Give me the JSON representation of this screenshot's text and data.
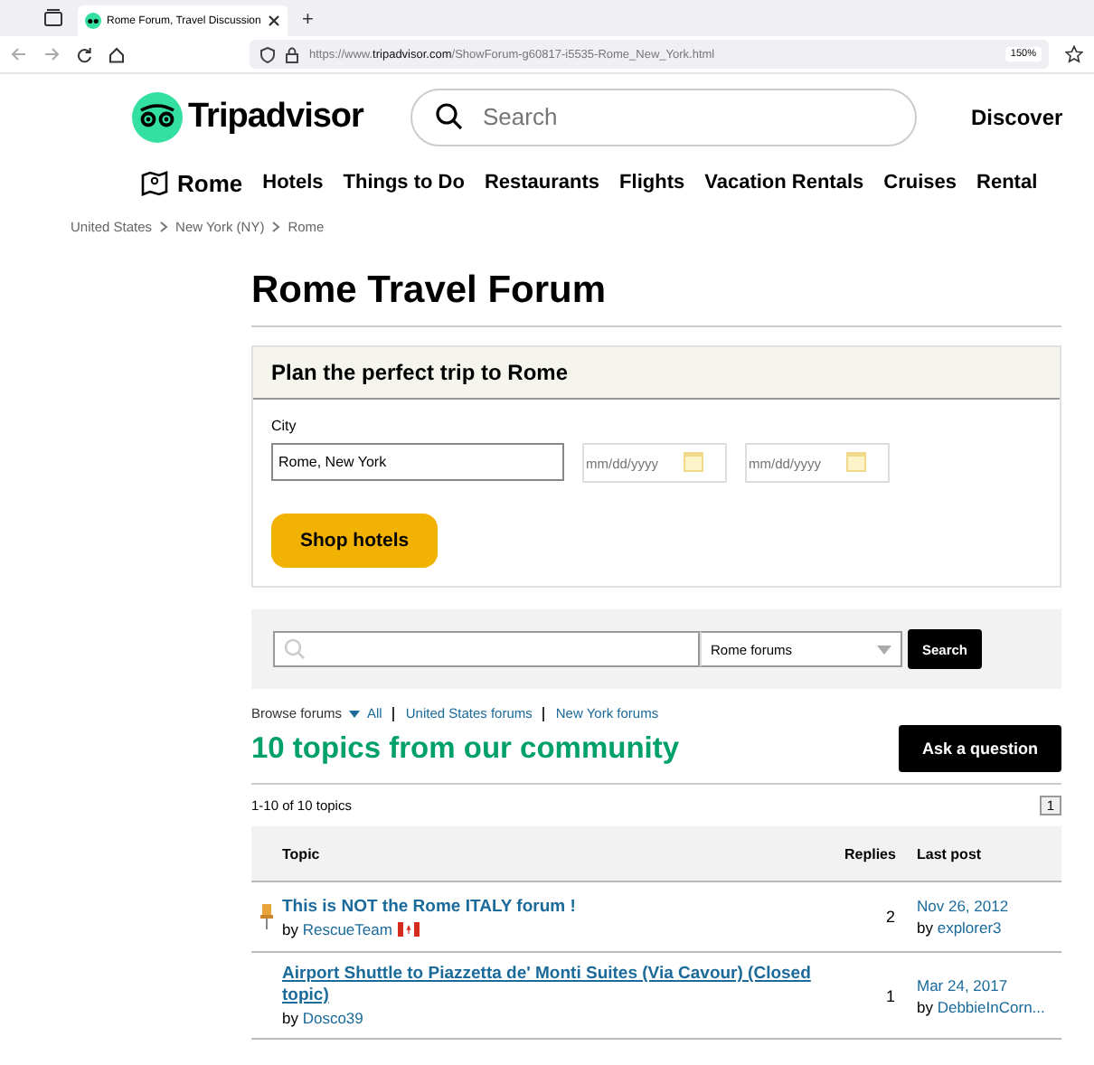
{
  "browser": {
    "tab_title": "Rome Forum, Travel Discussion",
    "new_tab": "+",
    "url_prefix": "https://www.",
    "url_domain": "tripadvisor.com",
    "url_path": "/ShowForum-g60817-i5535-Rome_New_York.html",
    "zoom": "150%"
  },
  "header": {
    "logo": "Tripadvisor",
    "search": {
      "placeholder": "Search"
    },
    "discover": "Discover"
  },
  "nav": [
    {
      "label": "Rome",
      "kind": "location"
    },
    {
      "label": "Hotels",
      "kind": "link"
    },
    {
      "label": "Things to Do",
      "kind": "link"
    },
    {
      "label": "Restaurants",
      "kind": "link"
    },
    {
      "label": "Flights",
      "kind": "link"
    },
    {
      "label": "Vacation Rentals",
      "kind": "link"
    },
    {
      "label": "Cruises",
      "kind": "link"
    },
    {
      "label": "Rental",
      "kind": "link"
    }
  ],
  "breadcrumb": [
    "United States",
    "New York (NY)",
    "Rome"
  ],
  "title": "Rome Travel Forum",
  "planner": {
    "heading": "Plan the perfect trip to Rome",
    "city_label": "City",
    "city_value": "Rome, New York",
    "checkin": {
      "placeholder": "mm/dd/yyyy"
    },
    "checkout": {
      "placeholder": "mm/dd/yyyy"
    },
    "button": "Shop hotels"
  },
  "forum_search": {
    "scope": "Rome forums",
    "button": "Search"
  },
  "browse": {
    "label": "Browse forums",
    "all": "All",
    "links": [
      "United States forums",
      "New York forums"
    ]
  },
  "topics_heading": "10 topics from our community",
  "ask_button": "Ask a question",
  "count": "1-10 of 10 topics",
  "page": "1",
  "table": {
    "columns": [
      "Topic",
      "Replies",
      "Last post"
    ],
    "rows": [
      {
        "title": "This is NOT the Rome ITALY forum !",
        "by": "by",
        "author": "RescueTeam",
        "flag": true,
        "pinned": true,
        "hovered": false,
        "replies": "2",
        "date": "Nov 26, 2012",
        "last_by": "by",
        "last_author": "explorer3"
      },
      {
        "title": "Airport Shuttle to Piazzetta de' Monti Suites (Via Cavour) (Closed topic)",
        "by": "by",
        "author": "Dosco39",
        "flag": false,
        "pinned": false,
        "hovered": true,
        "replies": "1",
        "date": "Mar 24, 2017",
        "last_by": "by",
        "last_author": "DebbieInCorn..."
      }
    ]
  }
}
